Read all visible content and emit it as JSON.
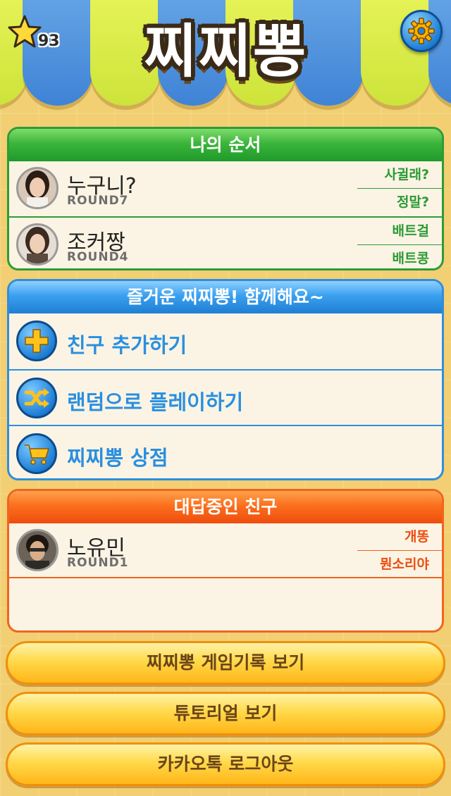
{
  "header": {
    "title": "찌찌뽕",
    "star_count": "93"
  },
  "my_turn": {
    "heading": "나의 순서",
    "players": [
      {
        "name": "누구니?",
        "round": "ROUND7",
        "actions": [
          "사귈래?",
          "정말?"
        ]
      },
      {
        "name": "조커짱",
        "round": "ROUND4",
        "actions": [
          "배트걸",
          "배트콩"
        ]
      }
    ]
  },
  "play": {
    "heading": "즐거운 찌찌뽕! 함께해요~",
    "items": [
      {
        "label": "친구 추가하기",
        "icon": "plus-icon"
      },
      {
        "label": "랜덤으로 플레이하기",
        "icon": "shuffle-icon"
      },
      {
        "label": "찌찌뽕 상점",
        "icon": "cart-icon"
      }
    ]
  },
  "answering": {
    "heading": "대답중인 친구",
    "players": [
      {
        "name": "노유민",
        "round": "ROUND1",
        "actions": [
          "개똥",
          "뭔소리야"
        ]
      }
    ]
  },
  "buttons": {
    "history": "찌찌뽕 게임기록 보기",
    "tutorial": "튜토리얼 보기",
    "logout": "카카오톡 로그아웃"
  },
  "colors": {
    "green": "#2e9b3a",
    "blue": "#2f8edb",
    "orange": "#f06422",
    "button_yellow": "#ffd94a"
  }
}
